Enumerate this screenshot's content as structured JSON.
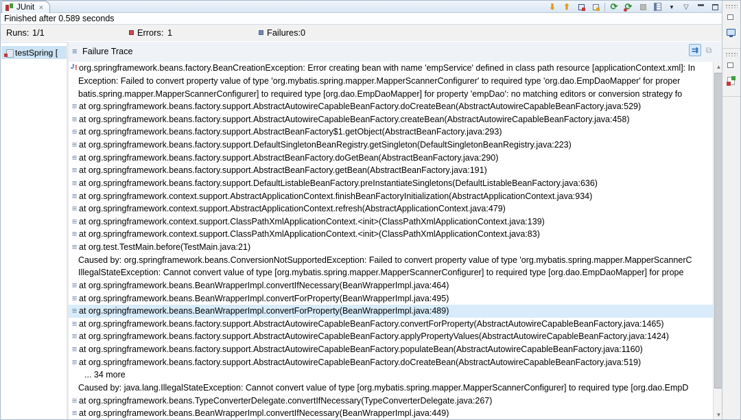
{
  "window": {
    "tab_label": "JUnit",
    "close_glyph": "✕"
  },
  "toolbar": {
    "next_failed_glyph": "⬇",
    "prev_failed_glyph": "⬆",
    "rerun_glyph": "⟳",
    "rerun_failed_glyph": "⟳",
    "history_dropdown_glyph": "▼",
    "view_menu_glyph": "▽"
  },
  "status": {
    "finished_text": "Finished after 0.589 seconds"
  },
  "counters": {
    "runs_label": "Runs:",
    "runs_value": "1/1",
    "errors_label": "Errors:",
    "errors_value": "1",
    "failures_label": "Failures:",
    "failures_value": "0"
  },
  "colors": {
    "progress_bar": "#9d4045",
    "error_icon": "#cc4a50",
    "failure_icon": "#7688ad",
    "selection": "#d9ecfb"
  },
  "test_tree": {
    "items": [
      {
        "text": "testSpring [",
        "selected": true
      }
    ]
  },
  "failure_trace": {
    "title": "Failure Trace",
    "header_icon_glyph": "≡",
    "filter_glyph": "⇉",
    "compare_glyph": "⧉",
    "scroll_up_glyph": "▲",
    "scroll_down_glyph": "▼",
    "lines": [
      {
        "icon": "exception",
        "ind": 0,
        "selected": false,
        "text": "org.springframework.beans.factory.BeanCreationException: Error creating bean with name 'empService' defined in class path resource [applicationContext.xml]: In"
      },
      {
        "icon": "none",
        "ind": 1,
        "selected": false,
        "text": "Exception: Failed to convert property value of type 'org.mybatis.spring.mapper.MapperScannerConfigurer' to required type 'org.dao.EmpDaoMapper' for proper"
      },
      {
        "icon": "none",
        "ind": 1,
        "selected": false,
        "text": "batis.spring.mapper.MapperScannerConfigurer] to required type [org.dao.EmpDaoMapper] for property 'empDao': no matching editors or conversion strategy fo"
      },
      {
        "icon": "frame",
        "ind": 0,
        "selected": false,
        "text": "at org.springframework.beans.factory.support.AbstractAutowireCapableBeanFactory.doCreateBean(AbstractAutowireCapableBeanFactory.java:529)"
      },
      {
        "icon": "frame",
        "ind": 0,
        "selected": false,
        "text": "at org.springframework.beans.factory.support.AbstractAutowireCapableBeanFactory.createBean(AbstractAutowireCapableBeanFactory.java:458)"
      },
      {
        "icon": "frame",
        "ind": 0,
        "selected": false,
        "text": "at org.springframework.beans.factory.support.AbstractBeanFactory$1.getObject(AbstractBeanFactory.java:293)"
      },
      {
        "icon": "frame",
        "ind": 0,
        "selected": false,
        "text": "at org.springframework.beans.factory.support.DefaultSingletonBeanRegistry.getSingleton(DefaultSingletonBeanRegistry.java:223)"
      },
      {
        "icon": "frame",
        "ind": 0,
        "selected": false,
        "text": "at org.springframework.beans.factory.support.AbstractBeanFactory.doGetBean(AbstractBeanFactory.java:290)"
      },
      {
        "icon": "frame",
        "ind": 0,
        "selected": false,
        "text": "at org.springframework.beans.factory.support.AbstractBeanFactory.getBean(AbstractBeanFactory.java:191)"
      },
      {
        "icon": "frame",
        "ind": 0,
        "selected": false,
        "text": "at org.springframework.beans.factory.support.DefaultListableBeanFactory.preInstantiateSingletons(DefaultListableBeanFactory.java:636)"
      },
      {
        "icon": "frame",
        "ind": 0,
        "selected": false,
        "text": "at org.springframework.context.support.AbstractApplicationContext.finishBeanFactoryInitialization(AbstractApplicationContext.java:934)"
      },
      {
        "icon": "frame",
        "ind": 0,
        "selected": false,
        "text": "at org.springframework.context.support.AbstractApplicationContext.refresh(AbstractApplicationContext.java:479)"
      },
      {
        "icon": "frame",
        "ind": 0,
        "selected": false,
        "text": "at org.springframework.context.support.ClassPathXmlApplicationContext.<init>(ClassPathXmlApplicationContext.java:139)"
      },
      {
        "icon": "frame",
        "ind": 0,
        "selected": false,
        "text": "at org.springframework.context.support.ClassPathXmlApplicationContext.<init>(ClassPathXmlApplicationContext.java:83)"
      },
      {
        "icon": "frame",
        "ind": 0,
        "selected": false,
        "text": "at org.test.TestMain.before(TestMain.java:21)"
      },
      {
        "icon": "none",
        "ind": 1,
        "selected": false,
        "text": "Caused by: org.springframework.beans.ConversionNotSupportedException: Failed to convert property value of type 'org.mybatis.spring.mapper.MapperScannerC"
      },
      {
        "icon": "none",
        "ind": 1,
        "selected": false,
        "text": "IllegalStateException: Cannot convert value of type [org.mybatis.spring.mapper.MapperScannerConfigurer] to required type [org.dao.EmpDaoMapper] for prope"
      },
      {
        "icon": "frame",
        "ind": 0,
        "selected": false,
        "text": "at org.springframework.beans.BeanWrapperImpl.convertIfNecessary(BeanWrapperImpl.java:464)"
      },
      {
        "icon": "frame",
        "ind": 0,
        "selected": false,
        "text": "at org.springframework.beans.BeanWrapperImpl.convertForProperty(BeanWrapperImpl.java:495)"
      },
      {
        "icon": "frame",
        "ind": 0,
        "selected": true,
        "text": "at org.springframework.beans.BeanWrapperImpl.convertForProperty(BeanWrapperImpl.java:489)"
      },
      {
        "icon": "frame",
        "ind": 0,
        "selected": false,
        "text": "at org.springframework.beans.factory.support.AbstractAutowireCapableBeanFactory.convertForProperty(AbstractAutowireCapableBeanFactory.java:1465)"
      },
      {
        "icon": "frame",
        "ind": 0,
        "selected": false,
        "text": "at org.springframework.beans.factory.support.AbstractAutowireCapableBeanFactory.applyPropertyValues(AbstractAutowireCapableBeanFactory.java:1424)"
      },
      {
        "icon": "frame",
        "ind": 0,
        "selected": false,
        "text": "at org.springframework.beans.factory.support.AbstractAutowireCapableBeanFactory.populateBean(AbstractAutowireCapableBeanFactory.java:1160)"
      },
      {
        "icon": "frame",
        "ind": 0,
        "selected": false,
        "text": "at org.springframework.beans.factory.support.AbstractAutowireCapableBeanFactory.doCreateBean(AbstractAutowireCapableBeanFactory.java:519)"
      },
      {
        "icon": "none",
        "ind": 2,
        "selected": false,
        "text": "... 34 more"
      },
      {
        "icon": "none",
        "ind": 1,
        "selected": false,
        "text": "Caused by: java.lang.IllegalStateException: Cannot convert value of type [org.mybatis.spring.mapper.MapperScannerConfigurer] to required type [org.dao.EmpD"
      },
      {
        "icon": "frame",
        "ind": 0,
        "selected": false,
        "text": "at org.springframework.beans.TypeConverterDelegate.convertIfNecessary(TypeConverterDelegate.java:267)"
      },
      {
        "icon": "frame",
        "ind": 0,
        "selected": false,
        "text": "at org.springframework.beans.BeanWrapperImpl.convertIfNecessary(BeanWrapperImpl.java:449)"
      }
    ]
  }
}
